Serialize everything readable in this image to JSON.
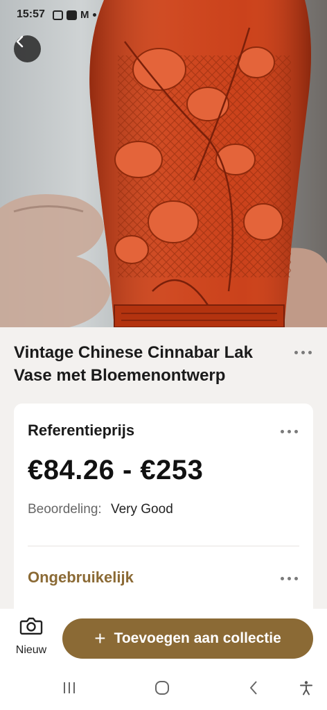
{
  "status_bar": {
    "time": "15:57",
    "ring_label": "ring"
  },
  "product": {
    "title": "Vintage Chinese Cinnabar Lak Vase met Bloemenontwerp"
  },
  "reference": {
    "label": "Referentieprijs",
    "price_range": "€84.26 - €253",
    "rating_label": "Beoordeling:",
    "rating_value": "Very Good"
  },
  "rarity": {
    "label": "Ongebruikelijk"
  },
  "actions": {
    "new_label": "Nieuw",
    "add_label": "Toevoegen aan collectie"
  },
  "colors": {
    "accent": "#8b6a35",
    "cinnabar": "#d2421c",
    "background": "#f3f1ef"
  },
  "icons": [
    "back-icon",
    "more-icon",
    "camera-icon",
    "plus-icon",
    "recent-apps-icon",
    "home-icon",
    "nav-back-icon",
    "accessibility-icon"
  ]
}
